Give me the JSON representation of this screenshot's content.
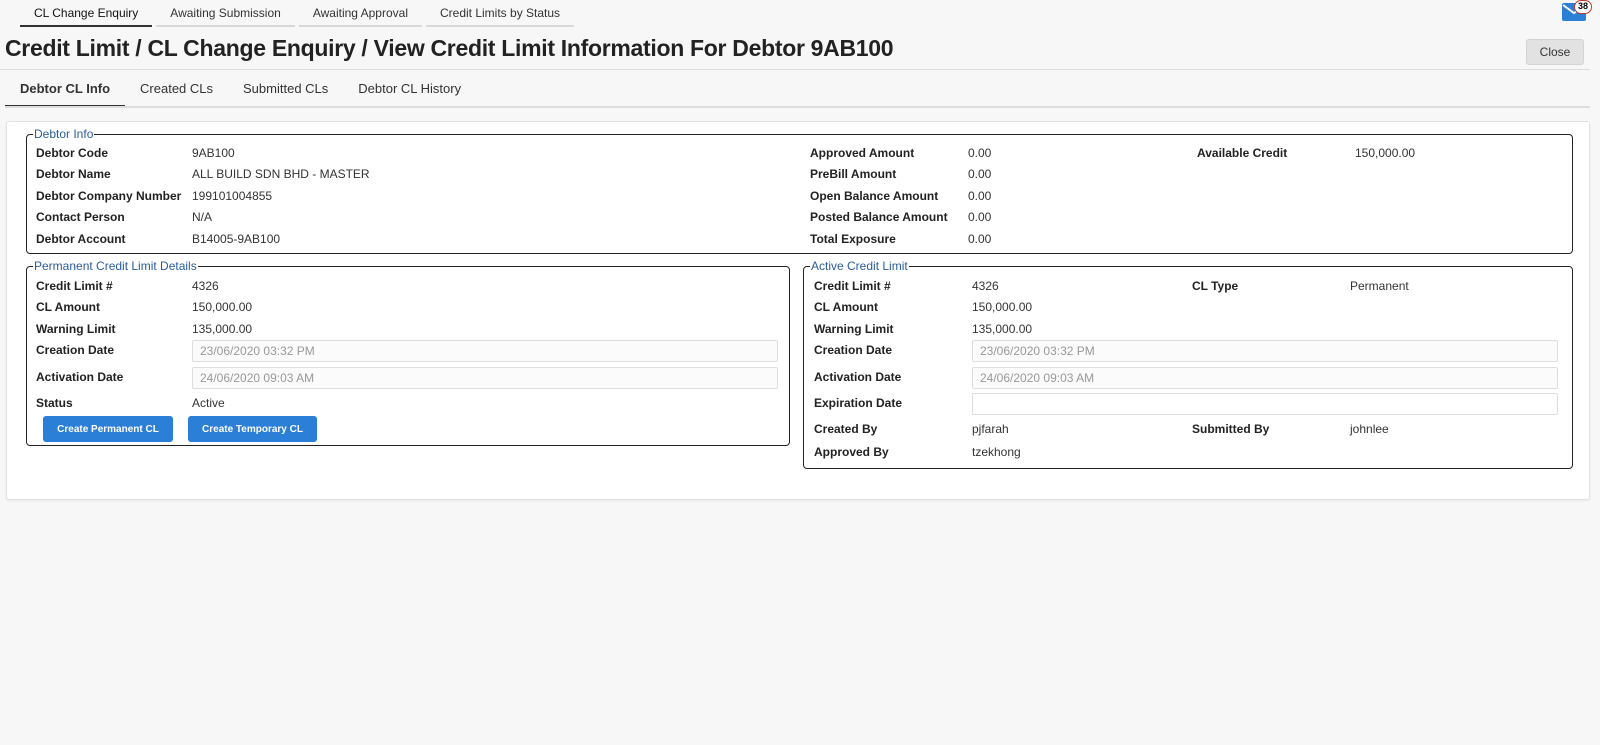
{
  "top_tabs": [
    "CL Change Enquiry",
    "Awaiting Submission",
    "Awaiting Approval",
    "Credit Limits by Status"
  ],
  "notifications": {
    "count": "38"
  },
  "page_title": "Credit Limit / CL Change Enquiry / View Credit Limit Information For Debtor 9AB100",
  "close_label": "Close",
  "sub_tabs": [
    "Debtor CL Info",
    "Created CLs",
    "Submitted CLs",
    "Debtor CL History"
  ],
  "debtor_info": {
    "legend": "Debtor Info",
    "labels": {
      "debtor_code": "Debtor Code",
      "debtor_name": "Debtor Name",
      "company_number": "Debtor Company Number",
      "contact_person": "Contact Person",
      "debtor_account": "Debtor Account",
      "approved_amount": "Approved Amount",
      "prebill_amount": "PreBill Amount",
      "open_balance": "Open Balance Amount",
      "posted_balance": "Posted Balance Amount",
      "total_exposure": "Total Exposure",
      "available_credit": "Available Credit"
    },
    "values": {
      "debtor_code": "9AB100",
      "debtor_name": "ALL BUILD SDN BHD - MASTER",
      "company_number": "199101004855",
      "contact_person": "N/A",
      "debtor_account": "B14005-9AB100",
      "approved_amount": "0.00",
      "prebill_amount": "0.00",
      "open_balance": "0.00",
      "posted_balance": "0.00",
      "total_exposure": "0.00",
      "available_credit": "150,000.00"
    }
  },
  "permanent_cl": {
    "legend": "Permanent Credit Limit Details",
    "labels": {
      "credit_limit_no": "Credit Limit #",
      "cl_amount": "CL Amount",
      "warning_limit": "Warning Limit",
      "creation_date": "Creation Date",
      "activation_date": "Activation Date",
      "status": "Status"
    },
    "values": {
      "credit_limit_no": "4326",
      "cl_amount": "150,000.00",
      "warning_limit": "135,000.00",
      "creation_date": "23/06/2020 03:32 PM",
      "activation_date": "24/06/2020 09:03 AM",
      "status": "Active"
    },
    "buttons": {
      "create_permanent": "Create Permanent CL",
      "create_temporary": "Create Temporary CL"
    }
  },
  "active_cl": {
    "legend": "Active Credit Limit",
    "labels": {
      "credit_limit_no": "Credit Limit #",
      "cl_type": "CL Type",
      "cl_amount": "CL Amount",
      "warning_limit": "Warning Limit",
      "creation_date": "Creation Date",
      "activation_date": "Activation Date",
      "expiration_date": "Expiration Date",
      "created_by": "Created By",
      "submitted_by": "Submitted By",
      "approved_by": "Approved By"
    },
    "values": {
      "credit_limit_no": "4326",
      "cl_type": "Permanent",
      "cl_amount": "150,000.00",
      "warning_limit": "135,000.00",
      "creation_date": "23/06/2020 03:32 PM",
      "activation_date": "24/06/2020 09:03 AM",
      "expiration_date": "",
      "created_by": "pjfarah",
      "submitted_by": "johnlee",
      "approved_by": "tzekhong"
    }
  },
  "colors": {
    "accent": "#2b7fd6",
    "legend": "#2a5d9a",
    "badge_border": "#c0392b"
  }
}
